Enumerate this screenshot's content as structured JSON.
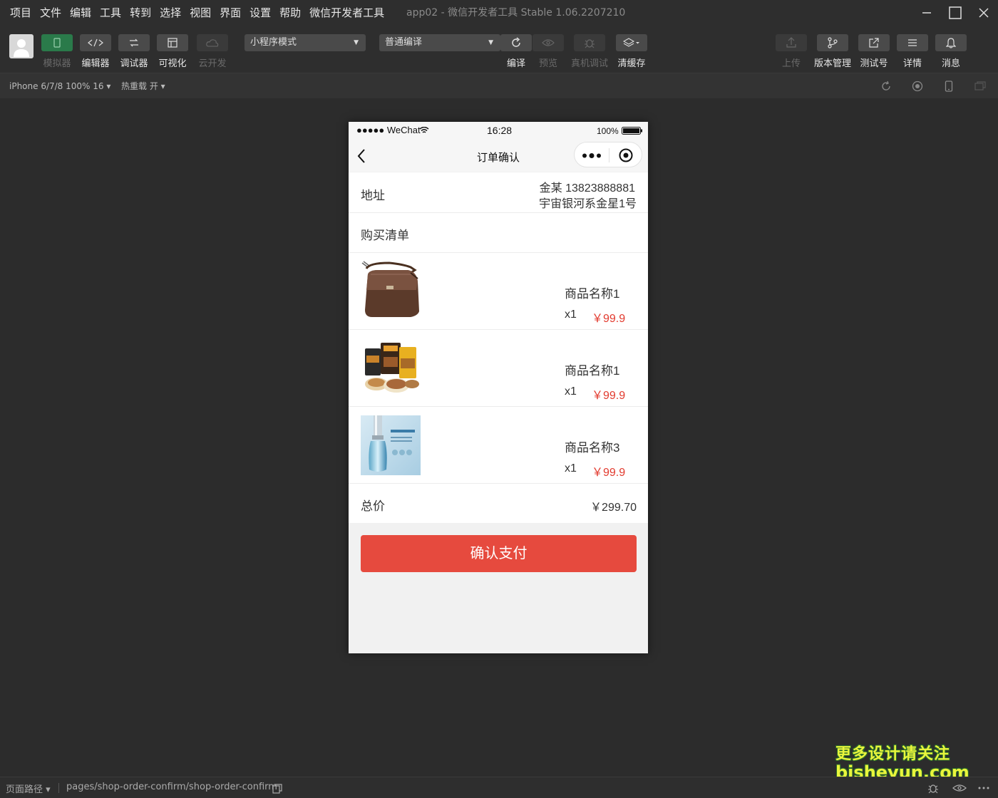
{
  "menu": [
    "项目",
    "文件",
    "编辑",
    "工具",
    "转到",
    "选择",
    "视图",
    "界面",
    "设置",
    "帮助",
    "微信开发者工具"
  ],
  "app_title": "app02 - 微信开发者工具 Stable 1.06.2207210",
  "toolbar": {
    "simulator": "模拟器",
    "editor": "编辑器",
    "debugger": "调试器",
    "visual": "可视化",
    "cloud": "云开发",
    "mode": "小程序模式",
    "compile_mode": "普通编译",
    "compile": "编译",
    "preview": "预览",
    "remote_debug": "真机调试",
    "clear_cache": "清缓存",
    "upload": "上传",
    "version": "版本管理",
    "test_account": "测试号",
    "details": "详情",
    "messages": "消息"
  },
  "devbar": {
    "device": "iPhone 6/7/8 100% 16 ▾",
    "hot_reload": "热重载 开 ▾"
  },
  "phone": {
    "status": {
      "carrier": "●●●●● WeChat",
      "time": "16:28",
      "battery": "100%"
    },
    "nav_title": "订单确认",
    "address_label": "地址",
    "address_name": "金某 13823888881",
    "address_detail": "宇宙银河系金星1号",
    "list_label": "购买清单",
    "items": [
      {
        "name": "商品名称1",
        "qty": "x1",
        "price": "￥99.9"
      },
      {
        "name": "商品名称1",
        "qty": "x1",
        "price": "￥99.9"
      },
      {
        "name": "商品名称3",
        "qty": "x1",
        "price": "￥99.9"
      }
    ],
    "total_label": "总价",
    "total_value": "￥299.70",
    "pay_button": "确认支付"
  },
  "bottom": {
    "path_label": "页面路径 ▾",
    "path": "pages/shop-order-confirm/shop-order-confirm"
  },
  "watermark": {
    "line1": "更多设计请关注",
    "line2": "bisheyun.com"
  }
}
